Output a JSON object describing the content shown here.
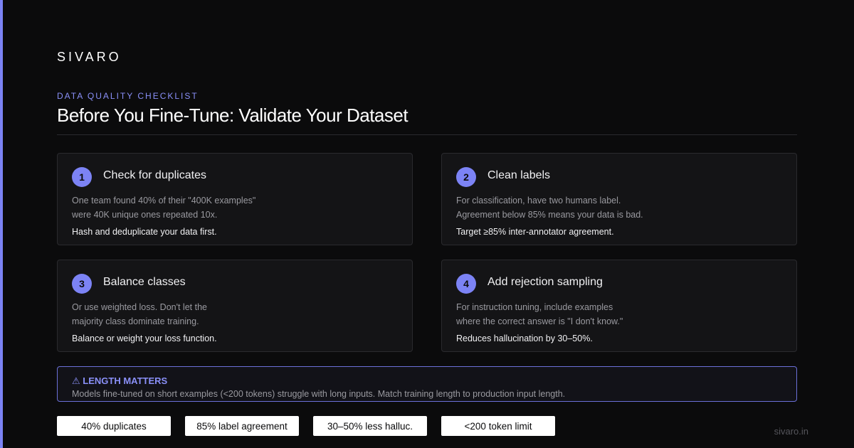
{
  "brand": "SIVARO",
  "eyebrow": "DATA QUALITY CHECKLIST",
  "title": "Before You Fine-Tune: Validate Your Dataset",
  "cards": [
    {
      "number": "1",
      "title": "Check for duplicates",
      "desc_lines": [
        "One team found 40% of their \"400K examples\"",
        "were 40K unique ones repeated 10x."
      ],
      "action": "Hash and deduplicate your data first."
    },
    {
      "number": "2",
      "title": "Clean labels",
      "desc_lines": [
        "For classification, have two humans label.",
        "Agreement below 85% means your data is bad."
      ],
      "action": "Target ≥85% inter-annotator agreement."
    },
    {
      "number": "3",
      "title": "Balance classes",
      "desc_lines": [
        "Or use weighted loss. Don't let the",
        "majority class dominate training."
      ],
      "action": "Balance or weight your loss function."
    },
    {
      "number": "4",
      "title": "Add rejection sampling",
      "desc_lines": [
        "For instruction tuning, include examples",
        "where the correct answer is \"I don't know.\""
      ],
      "action": "Reduces hallucination by 30–50%."
    }
  ],
  "callout": {
    "title": "⚠ LENGTH MATTERS",
    "text": "Models fine-tuned on short examples (<200 tokens) struggle with long inputs. Match training length to production input length."
  },
  "stats": [
    "40% duplicates",
    "85% label agreement",
    "30–50% less halluc.",
    "<200 token limit"
  ],
  "footer_url": "sivaro.in",
  "colors": {
    "accent": "#7c83f5",
    "background": "#0b0b0c",
    "card_bg": "#141416",
    "card_border": "#2a2a2e"
  }
}
